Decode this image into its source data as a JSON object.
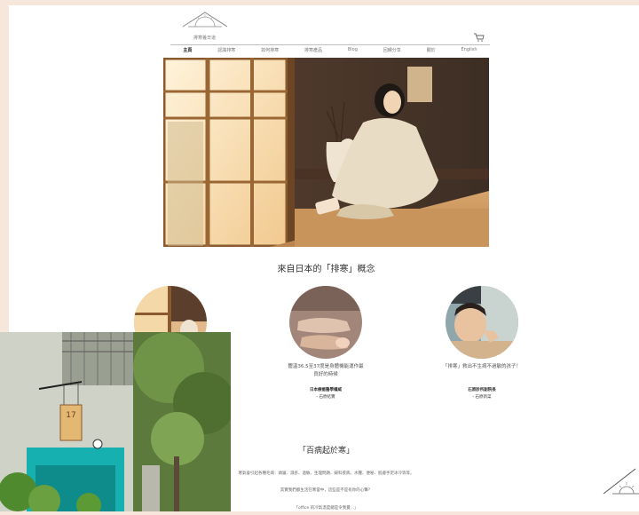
{
  "brand": {
    "logo_text": "排寒養日道"
  },
  "nav": {
    "items": [
      {
        "label": "主頁",
        "active": true
      },
      {
        "label": "認識排寒",
        "active": false
      },
      {
        "label": "如何排寒",
        "active": false
      },
      {
        "label": "排寒產品",
        "active": false
      },
      {
        "label": "Blog",
        "active": false
      },
      {
        "label": "回饋分享",
        "active": false
      },
      {
        "label": "關於",
        "active": false
      },
      {
        "label": "English",
        "active": false
      }
    ]
  },
  "sections": {
    "concept_title": "來自日本的「排寒」概念",
    "cards": [
      {
        "text_lines": [],
        "sub_bold": "",
        "sub": ""
      },
      {
        "text_lines": [
          "體溫36.5至37度是身體機能運作最",
          "良好的時候"
        ],
        "sub_bold": "日本療癒醫學權威",
        "sub": "- 石原結實"
      },
      {
        "text_lines": [
          "「排寒」救出不生病不過敏的孩子！"
        ],
        "sub_bold": "石原診所副院長",
        "sub": "- 石原新菜"
      }
    ],
    "illness_title": "「百病起於寒」",
    "paragraphs": [
      "寒氣會引起各種毛病：頭寢、濕疹、過敏、生理問題、婦科疾病、水腫、便秘、肌膚手足冰冷等等。",
      "其實我們都生活在寒當中，這些是不是有你的心聲？",
      "「office 的冷氣溫度總是令我覺...」"
    ]
  },
  "colors": {
    "accent": "#c9a27a",
    "background": "#f7e6dc"
  },
  "icons": {
    "cart": "cart-icon",
    "logo": "mountain-sun-logo"
  }
}
